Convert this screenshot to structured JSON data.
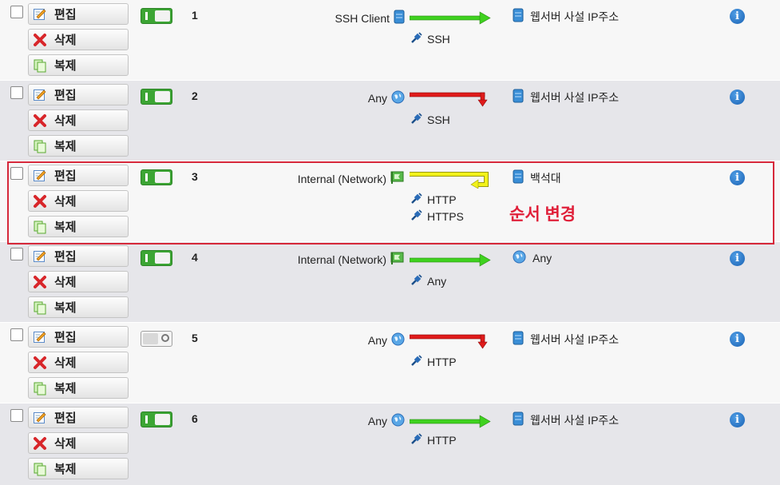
{
  "buttons": {
    "edit": "편집",
    "delete": "삭제",
    "copy": "복제"
  },
  "rows": [
    {
      "num": "1",
      "enabled": true,
      "source": "SSH Client",
      "source_icon": "server-icon",
      "action": "allow",
      "services": [
        "SSH"
      ],
      "destination": "웹서버 사설 IP주소",
      "destination_icon": "server-icon"
    },
    {
      "num": "2",
      "enabled": true,
      "source": "Any",
      "source_icon": "globe-icon",
      "action": "drop",
      "services": [
        "SSH"
      ],
      "destination": "웹서버 사설 IP주소",
      "destination_icon": "server-icon"
    },
    {
      "num": "3",
      "enabled": true,
      "source": "Internal (Network)",
      "source_icon": "network-flag-icon",
      "action": "redirect",
      "services": [
        "HTTP",
        "HTTPS"
      ],
      "destination": "백석대",
      "destination_icon": "server-icon"
    },
    {
      "num": "4",
      "enabled": true,
      "source": "Internal (Network)",
      "source_icon": "network-flag-icon",
      "action": "allow",
      "services": [
        "Any"
      ],
      "destination": "Any",
      "destination_icon": "globe-icon"
    },
    {
      "num": "5",
      "enabled": false,
      "source": "Any",
      "source_icon": "globe-icon",
      "action": "drop",
      "services": [
        "HTTP"
      ],
      "destination": "웹서버 사설 IP주소",
      "destination_icon": "server-icon"
    },
    {
      "num": "6",
      "enabled": true,
      "source": "Any",
      "source_icon": "globe-icon",
      "action": "allow",
      "services": [
        "HTTP"
      ],
      "destination": "웹서버 사설 IP주소",
      "destination_icon": "server-icon"
    }
  ],
  "annotation": {
    "text": "순서 변경",
    "color": "#e0203a"
  },
  "colors": {
    "allow": "#3fd21f",
    "drop": "#e01b1b",
    "redirect": "#f2f21a",
    "toggle_on": "#3ca534"
  }
}
